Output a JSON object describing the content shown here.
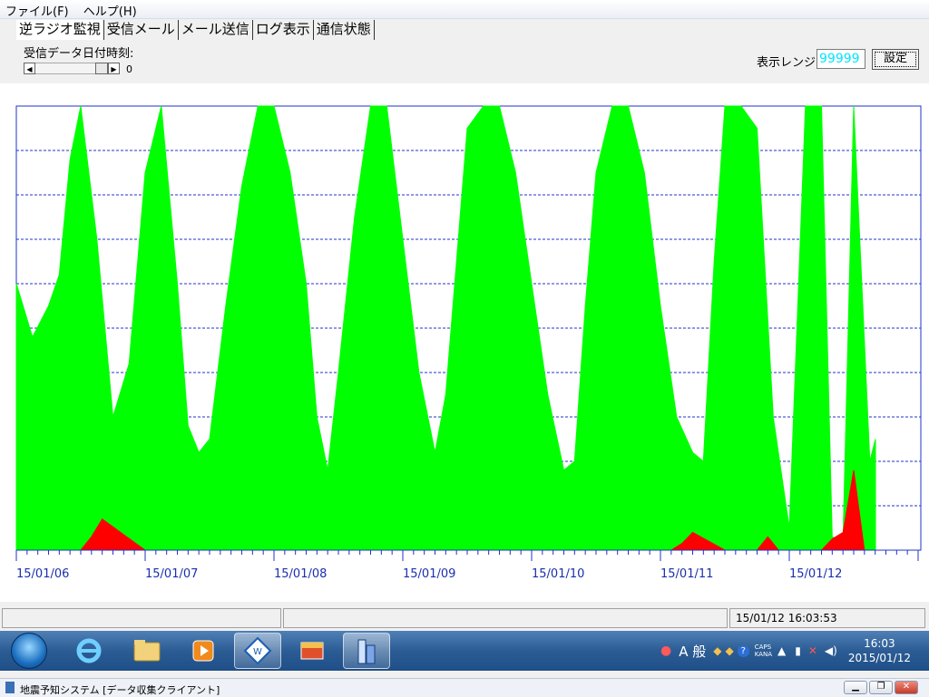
{
  "menu": [
    "ファイル(F)",
    "ヘルプ(H)"
  ],
  "tabs": [
    {
      "label": "逆ラジオ監視",
      "active": true
    },
    {
      "label": "受信メール",
      "active": false
    },
    {
      "label": "メール送信",
      "active": false
    },
    {
      "label": "ログ表示",
      "active": false
    },
    {
      "label": "通信状態",
      "active": false
    }
  ],
  "controls": {
    "date_label": "受信データ日付時刻:",
    "scroll_value": "0",
    "range_label": "表示レンジ:",
    "range_value": "99999",
    "set_button": "設定"
  },
  "chart_data": {
    "type": "area",
    "x_tick_labels": [
      "15/01/06",
      "15/01/07",
      "15/01/08",
      "15/01/09",
      "15/01/10",
      "15/01/11",
      "15/01/12"
    ],
    "ylim": [
      0,
      99999
    ],
    "grid": true,
    "series": [
      {
        "color": "#00ff00",
        "x": [
          "15/01/06 00:00",
          "15/01/06 03:00",
          "15/01/06 06:00",
          "15/01/06 08:00",
          "15/01/06 10:00",
          "15/01/06 12:00",
          "15/01/06 15:00",
          "15/01/06 18:00",
          "15/01/06 21:00",
          "15/01/07 00:00",
          "15/01/07 03:00",
          "15/01/07 06:00",
          "15/01/07 08:00",
          "15/01/07 10:00",
          "15/01/07 12:00",
          "15/01/07 15:00",
          "15/01/07 18:00",
          "15/01/07 21:00",
          "15/01/08 00:00",
          "15/01/08 03:00",
          "15/01/08 06:00",
          "15/01/08 08:00",
          "15/01/08 10:00",
          "15/01/08 12:00",
          "15/01/08 15:00",
          "15/01/08 18:00",
          "15/01/08 21:00",
          "15/01/09 00:00",
          "15/01/09 03:00",
          "15/01/09 06:00",
          "15/01/09 08:00",
          "15/01/09 10:00",
          "15/01/09 12:00",
          "15/01/09 15:00",
          "15/01/09 18:00",
          "15/01/09 21:00",
          "15/01/10 00:00",
          "15/01/10 03:00",
          "15/01/10 06:00",
          "15/01/10 08:00",
          "15/01/10 10:00",
          "15/01/10 12:00",
          "15/01/10 15:00",
          "15/01/10 18:00",
          "15/01/10 21:00",
          "15/01/11 00:00",
          "15/01/11 03:00",
          "15/01/11 06:00",
          "15/01/11 08:00",
          "15/01/11 10:00",
          "15/01/11 12:00",
          "15/01/11 15:00",
          "15/01/11 18:00",
          "15/01/11 21:00",
          "15/01/12 00:00",
          "15/01/12 03:00",
          "15/01/12 06:00",
          "15/01/12 08:00",
          "15/01/12 10:00",
          "15/01/12 12:00",
          "15/01/12 15:00",
          "15/01/12 16:03"
        ],
        "values": [
          60000,
          48000,
          55000,
          62000,
          88000,
          99999,
          70000,
          30000,
          42000,
          85000,
          99999,
          60000,
          28000,
          22000,
          25000,
          55000,
          82000,
          99999,
          99999,
          85000,
          60000,
          30000,
          18000,
          40000,
          75000,
          99999,
          99999,
          70000,
          40000,
          22000,
          35000,
          65000,
          95000,
          99999,
          99999,
          85000,
          60000,
          35000,
          18000,
          20000,
          55000,
          85000,
          99999,
          99999,
          85000,
          55000,
          30000,
          22000,
          20000,
          65000,
          99999,
          99999,
          95000,
          30000,
          5000,
          99999,
          99999,
          3000,
          2000,
          99999,
          20000,
          25000
        ]
      },
      {
        "color": "#ff0000",
        "x": [
          "15/01/06 00:00",
          "15/01/06 12:00",
          "15/01/06 14:00",
          "15/01/06 16:00",
          "15/01/07 00:00",
          "15/01/10 00:00",
          "15/01/11 00:00",
          "15/01/11 02:00",
          "15/01/11 04:00",
          "15/01/11 06:00",
          "15/01/11 12:00",
          "15/01/11 18:00",
          "15/01/11 20:00",
          "15/01/11 22:00",
          "15/01/12 00:00",
          "15/01/12 06:00",
          "15/01/12 08:00",
          "15/01/12 10:00",
          "15/01/12 12:00",
          "15/01/12 14:00",
          "15/01/12 16:03"
        ],
        "values": [
          0,
          0,
          3000,
          7000,
          0,
          0,
          0,
          0,
          1500,
          4000,
          0,
          0,
          3000,
          0,
          0,
          0,
          2500,
          4000,
          18000,
          0,
          0
        ]
      }
    ]
  },
  "status": {
    "datetime": "15/01/12 16:03:53"
  },
  "taskbar": {
    "ime": "A 般",
    "caps": "CAPS",
    "kana": "KANA",
    "time": "16:03",
    "date": "2015/01/12"
  },
  "title_bar": {
    "text": "地震予知システム [データ収集クライアント]"
  }
}
